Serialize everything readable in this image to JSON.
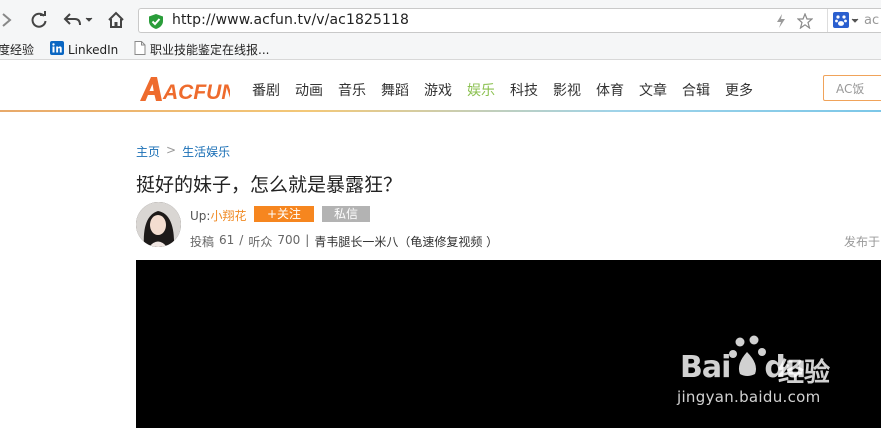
{
  "browser": {
    "url": "http://www.acfun.tv/v/ac1825118",
    "search_stub": "ac"
  },
  "bookmarks": [
    {
      "label": "度经验"
    },
    {
      "label": "LinkedIn"
    },
    {
      "label": "职业技能鉴定在线报..."
    }
  ],
  "site": {
    "logo_text": "ACFUN",
    "nav": [
      "番剧",
      "动画",
      "音乐",
      "舞蹈",
      "游戏",
      "娱乐",
      "科技",
      "影视",
      "体育",
      "文章",
      "合辑",
      "更多"
    ],
    "active_nav": "娱乐",
    "search_placeholder": "AC饭"
  },
  "breadcrumb": {
    "home": "主页",
    "separator": ">",
    "category": "生活娱乐"
  },
  "video": {
    "title": "挺好的妹子，怎么就是暴露狂？",
    "up_prefix": "Up:",
    "uploader": "小翔花",
    "follow_label": "+关注",
    "message_label": "私信",
    "posts_label": "投稿",
    "posts_count": "61",
    "stat_sep": "/",
    "fans_label": "听众",
    "fans_count": "700",
    "pipe": "|",
    "signature": "青韦腿长一米八（龟速修复视频 ）",
    "publish_label": "发布于"
  },
  "watermark": {
    "logo": "Bai",
    "logo_suffix": "du",
    "cn": "经验",
    "url": "jingyan.baidu.com"
  },
  "colors": {
    "brand_orange": "#f6861f",
    "nav_active": "#8cc152",
    "link_blue": "#1a6fb6",
    "shield_green": "#2a9d3a"
  }
}
